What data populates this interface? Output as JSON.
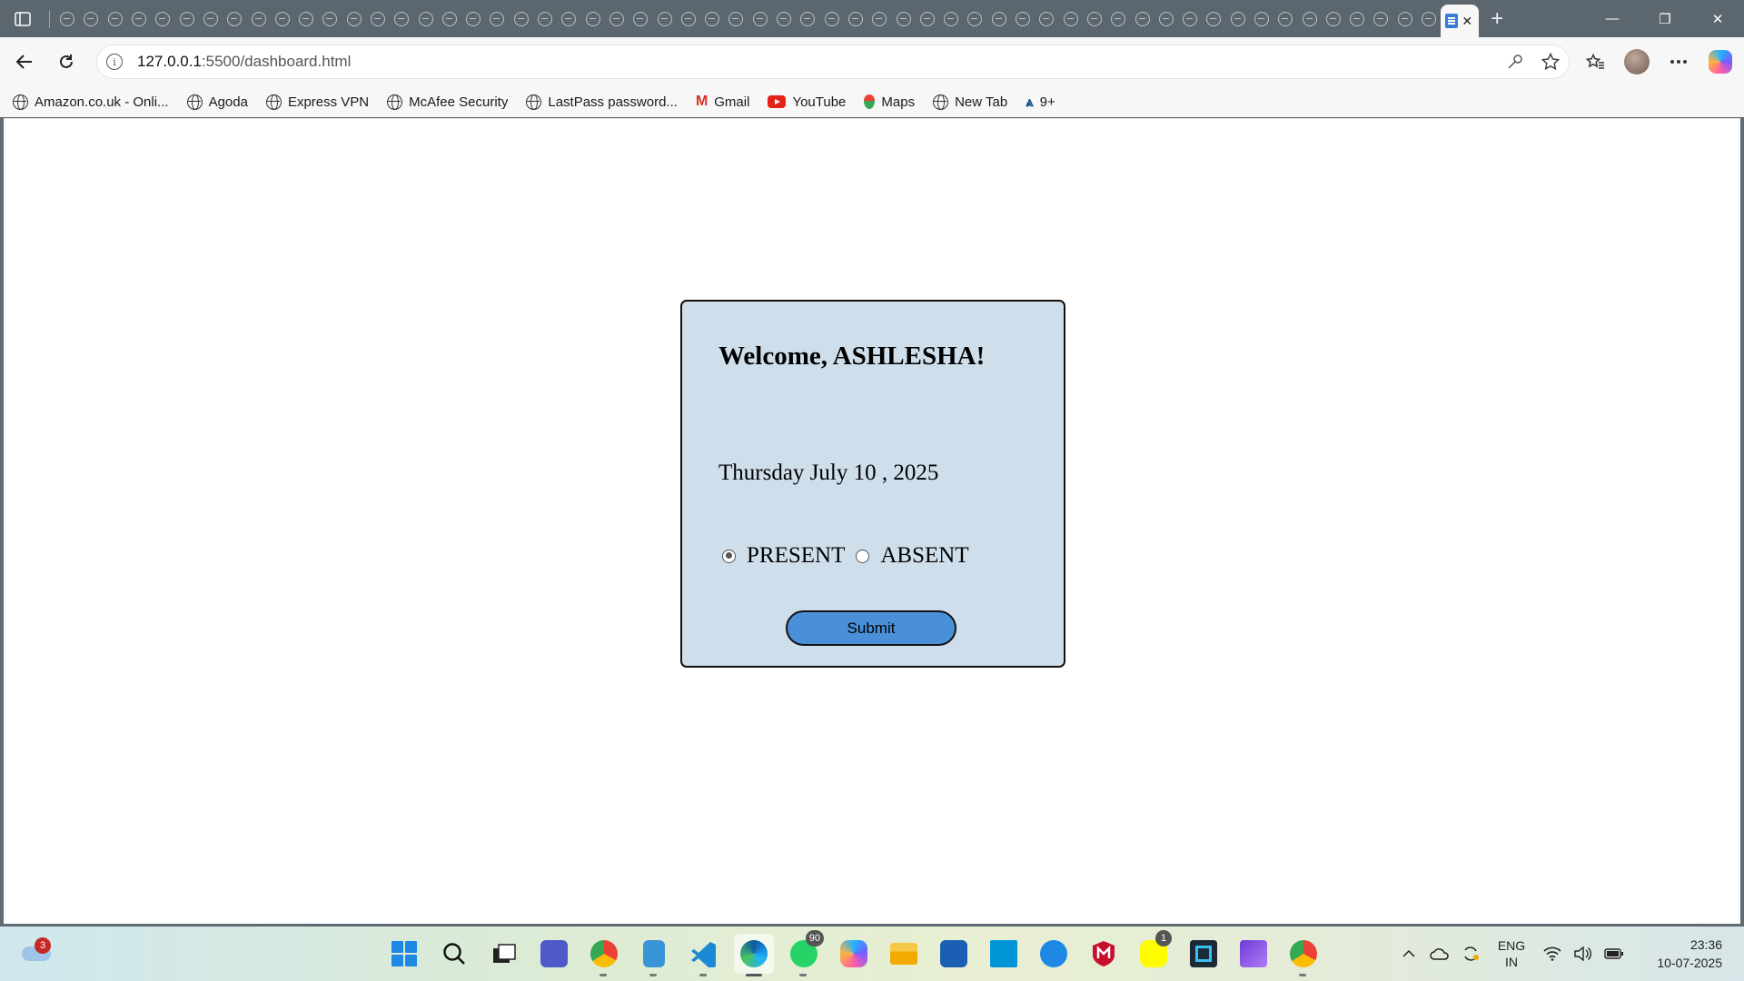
{
  "browser": {
    "tab_count_mini": 58,
    "active_tab_icon": "document-icon",
    "close_tab_symbol": "✕",
    "new_tab_symbol": "+",
    "window": {
      "minimize": "—",
      "restore": "❐",
      "close": "✕"
    }
  },
  "toolbar": {
    "url_host": "127.0.0.1",
    "url_path": ":5500/dashboard.html"
  },
  "bookmarks": [
    {
      "label": "Amazon.co.uk - Onli...",
      "icon": "globe-icon"
    },
    {
      "label": "Agoda",
      "icon": "globe-icon"
    },
    {
      "label": "Express VPN",
      "icon": "globe-icon"
    },
    {
      "label": "McAfee Security",
      "icon": "globe-icon"
    },
    {
      "label": "LastPass password...",
      "icon": "globe-icon"
    },
    {
      "label": "Gmail",
      "icon": "gmail-icon"
    },
    {
      "label": "YouTube",
      "icon": "youtube-icon"
    },
    {
      "label": "Maps",
      "icon": "maps-icon"
    },
    {
      "label": "New Tab",
      "icon": "globe-icon"
    },
    {
      "label": "9+",
      "icon": "folder-icon"
    }
  ],
  "page": {
    "welcome": "Welcome, ASHLESHA!",
    "date": "Thursday July 10 , 2025",
    "attendance": {
      "options": [
        "PRESENT",
        "ABSENT"
      ],
      "selected": "PRESENT"
    },
    "submit_label": "Submit",
    "card_bg": "#cfdeeb",
    "button_bg": "#4a90d9"
  },
  "taskbar": {
    "weather_badge": "3",
    "whatsapp_badge": "90",
    "snapchat_badge": "1",
    "language_line1": "ENG",
    "language_line2": "IN",
    "time": "23:36",
    "date": "10-07-2025"
  }
}
